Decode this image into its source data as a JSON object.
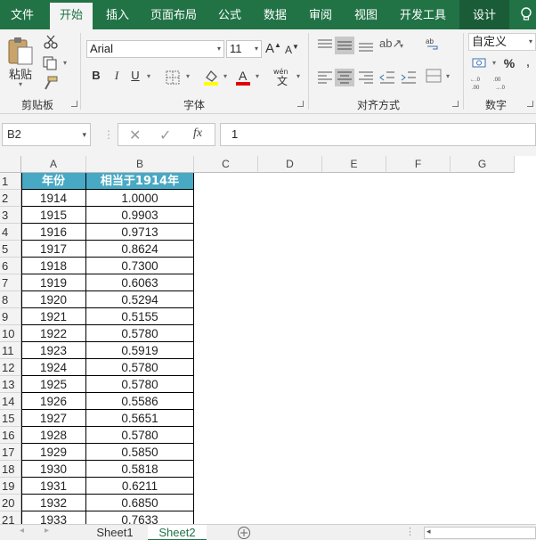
{
  "tabs": [
    "文件",
    "开始",
    "插入",
    "页面布局",
    "公式",
    "数据",
    "审阅",
    "视图",
    "开发工具",
    "设计"
  ],
  "active_tab": "开始",
  "ribbon": {
    "clipboard": {
      "paste_label": "粘贴",
      "group_label": "剪贴板"
    },
    "font": {
      "font_name": "Arial",
      "font_size": "11",
      "group_label": "字体",
      "bold": "B",
      "italic": "I",
      "underline": "U"
    },
    "alignment": {
      "group_label": "对齐方式"
    },
    "number": {
      "format": "自定义",
      "group_label": "数字",
      "percent": "%"
    }
  },
  "formula_bar": {
    "name_box": "B2",
    "formula": "1",
    "fx": "fx"
  },
  "columns": [
    "A",
    "B",
    "C",
    "D",
    "E",
    "F",
    "G"
  ],
  "table": {
    "headers": [
      "年份",
      "相当于1914年"
    ],
    "rows": [
      [
        "1914",
        "1.0000"
      ],
      [
        "1915",
        "0.9903"
      ],
      [
        "1916",
        "0.9713"
      ],
      [
        "1917",
        "0.8624"
      ],
      [
        "1918",
        "0.7300"
      ],
      [
        "1919",
        "0.6063"
      ],
      [
        "1920",
        "0.5294"
      ],
      [
        "1921",
        "0.5155"
      ],
      [
        "1922",
        "0.5780"
      ],
      [
        "1923",
        "0.5919"
      ],
      [
        "1924",
        "0.5780"
      ],
      [
        "1925",
        "0.5780"
      ],
      [
        "1926",
        "0.5586"
      ],
      [
        "1927",
        "0.5651"
      ],
      [
        "1928",
        "0.5780"
      ],
      [
        "1929",
        "0.5850"
      ],
      [
        "1930",
        "0.5818"
      ],
      [
        "1931",
        "0.6211"
      ],
      [
        "1932",
        "0.6850"
      ],
      [
        "1933",
        "0.7633"
      ]
    ]
  },
  "row_numbers": [
    "1",
    "2",
    "3",
    "4",
    "5",
    "6",
    "7",
    "8",
    "9",
    "10",
    "11",
    "12",
    "13",
    "14",
    "15",
    "16",
    "17",
    "18",
    "19",
    "20",
    "21"
  ],
  "sheets": [
    "Sheet1",
    "Sheet2"
  ],
  "active_sheet": "Sheet2",
  "colors": {
    "brand": "#217346",
    "header_fill": "#48a9c5"
  }
}
